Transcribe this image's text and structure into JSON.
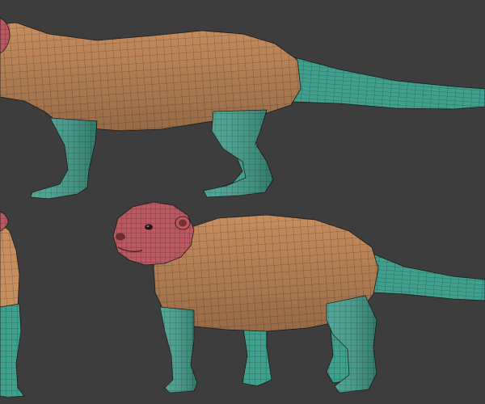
{
  "scene": {
    "background": "#3d3d3d",
    "wire": "#1b1b1b",
    "groups": {
      "body": "#c88e5e",
      "limbs_tail": "#3fa08d",
      "head": "#c0575f"
    },
    "views": [
      {
        "name": "side-view",
        "visible": "partial"
      },
      {
        "name": "front-view",
        "visible": "partial"
      },
      {
        "name": "three-quarter-view",
        "visible": "full"
      }
    ]
  }
}
